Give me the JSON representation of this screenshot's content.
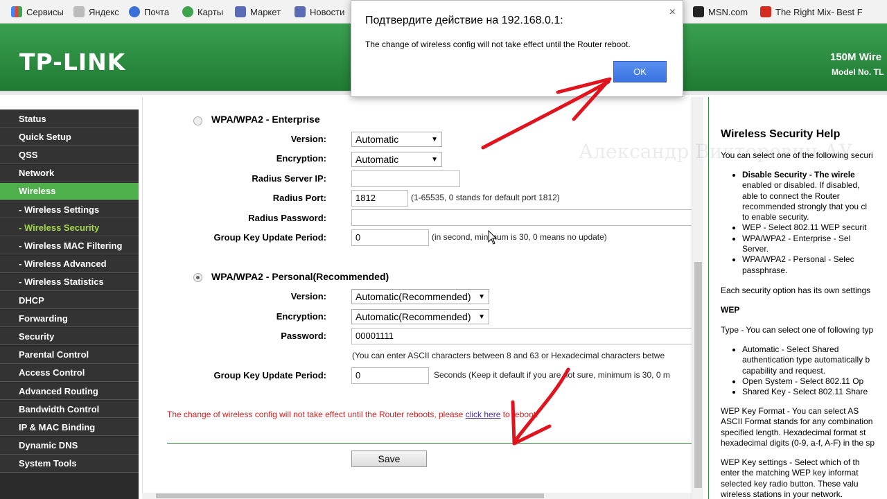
{
  "bookmarks": [
    {
      "label": "Сервисы",
      "icon": "apps-icon",
      "color": "#4285f4"
    },
    {
      "label": "Яндекс",
      "icon": "yandex-icon",
      "color": "#999999"
    },
    {
      "label": "Почта",
      "icon": "mail-icon",
      "color": "#3b6fd8"
    },
    {
      "label": "Карты",
      "icon": "maps-icon",
      "color": "#3fa34d"
    },
    {
      "label": "Маркет",
      "icon": "market-icon",
      "color": "#5a6bb5"
    },
    {
      "label": "Новости",
      "icon": "news-icon",
      "color": "#5a6bb5"
    },
    {
      "label": "MSN.com",
      "icon": "msn-icon",
      "color": "#222222"
    },
    {
      "label": "The Right Mix- Best F",
      "icon": "gb-icon",
      "color": "#d42a1f"
    }
  ],
  "header": {
    "logo": "TP-LINK",
    "model_title": "150M Wire",
    "model_no": "Model No. TL"
  },
  "sidebar": {
    "items": [
      {
        "label": "Status",
        "state": "normal"
      },
      {
        "label": "Quick Setup",
        "state": "normal"
      },
      {
        "label": "QSS",
        "state": "normal"
      },
      {
        "label": "Network",
        "state": "normal"
      },
      {
        "label": "Wireless",
        "state": "active"
      },
      {
        "label": "- Wireless Settings",
        "state": "sub"
      },
      {
        "label": "- Wireless Security",
        "state": "sub-current"
      },
      {
        "label": "- Wireless MAC Filtering",
        "state": "sub"
      },
      {
        "label": "- Wireless Advanced",
        "state": "sub"
      },
      {
        "label": "- Wireless Statistics",
        "state": "sub"
      },
      {
        "label": "DHCP",
        "state": "normal"
      },
      {
        "label": "Forwarding",
        "state": "normal"
      },
      {
        "label": "Security",
        "state": "normal"
      },
      {
        "label": "Parental Control",
        "state": "normal"
      },
      {
        "label": "Access Control",
        "state": "normal"
      },
      {
        "label": "Advanced Routing",
        "state": "normal"
      },
      {
        "label": "Bandwidth Control",
        "state": "normal"
      },
      {
        "label": "IP & MAC Binding",
        "state": "normal"
      },
      {
        "label": "Dynamic DNS",
        "state": "normal"
      },
      {
        "label": "System Tools",
        "state": "normal"
      }
    ]
  },
  "enterprise": {
    "title": "WPA/WPA2 - Enterprise",
    "version_label": "Version:",
    "version_value": "Automatic",
    "encryption_label": "Encryption:",
    "encryption_value": "Automatic",
    "radius_ip_label": "Radius Server IP:",
    "radius_ip_value": "",
    "radius_port_label": "Radius Port:",
    "radius_port_value": "1812",
    "radius_port_note": "(1-65535, 0 stands for default port 1812)",
    "radius_password_label": "Radius Password:",
    "radius_password_value": "",
    "group_key_label": "Group Key Update Period:",
    "group_key_value": "0",
    "group_key_note": "(in second, minimum is 30, 0 means no update)"
  },
  "personal": {
    "title": "WPA/WPA2 - Personal(Recommended)",
    "version_label": "Version:",
    "version_value": "Automatic(Recommended)",
    "encryption_label": "Encryption:",
    "encryption_value": "Automatic(Recommended)",
    "password_label": "Password:",
    "password_value": "00001111",
    "password_note": "(You can enter ASCII characters between 8 and 63 or Hexadecimal characters betwe",
    "group_key_label": "Group Key Update Period:",
    "group_key_value": "0",
    "group_key_note": "Seconds (Keep it default if you are not sure, minimum is 30, 0 m"
  },
  "reboot_notice": {
    "text": "The change of wireless config will not take effect until the Router reboots, please ",
    "link": "click here",
    "after": " to reboot."
  },
  "save_label": "Save",
  "help": {
    "title": "Wireless Security Help",
    "intro": "You can select one of the following securi",
    "list1": [
      "Disable Security - The wirele",
      "enabled or disabled. If disabled,",
      "able to connect the Router",
      "recommended strongly that you cl",
      "to enable security.",
      "WEP - Select 802.11 WEP securit",
      "WPA/WPA2 - Enterprise - Sel",
      "Server.",
      "WPA/WPA2 - Personal - Selec",
      "passphrase."
    ],
    "each": "Each security option has its own settings",
    "wep_head": "WEP",
    "type_line": "Type - You can select one of following typ",
    "list2": [
      "Automatic - Select Shared",
      "authentication type automatically b",
      "capability and request.",
      "Open System - Select 802.11 Op",
      "Shared Key - Select 802.11 Share"
    ],
    "wep_format": [
      "WEP Key Format - You can select AS",
      "ASCII Format stands for any combination",
      "specified length. Hexadecimal format st",
      "hexadecimal digits (0-9, a-f, A-F) in the sp"
    ],
    "wep_settings": [
      "WEP Key settings - Select which of th",
      "enter the matching WEP key informat",
      "selected key radio button. These valu",
      "wireless stations in your network."
    ]
  },
  "watermark": "Александр Викторович АУ",
  "dialog": {
    "title": "Подтвердите действие на 192.168.0.1:",
    "message": "The change of wireless config will not take effect until the Router reboot.",
    "ok": "OK",
    "close": "×"
  },
  "colors": {
    "brand_green": "#2c8d3f",
    "sidebar_bg": "#333333",
    "sidebar_active": "#4db04b",
    "annotation_red": "#e0141e"
  }
}
